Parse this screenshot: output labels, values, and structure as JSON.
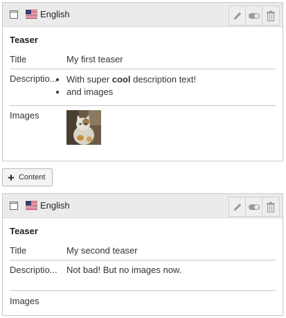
{
  "elements": [
    {
      "language": "English",
      "content_type": "Teaser",
      "fields": {
        "title_label": "Title",
        "title_value": "My first teaser",
        "description_label": "Descriptio...",
        "description_items": [
          {
            "before": "With super ",
            "bold": "cool",
            "after": " description text!"
          },
          {
            "before": "and images",
            "bold": "",
            "after": ""
          }
        ],
        "images_label": "Images"
      }
    },
    {
      "language": "English",
      "content_type": "Teaser",
      "fields": {
        "title_label": "Title",
        "title_value": "My second teaser",
        "description_label": "Descriptio...",
        "description_text": "Not bad! But no images now.",
        "images_label": "Images"
      }
    }
  ],
  "add_button_label": "Content",
  "icons": {
    "collapse": "collapse-toggle-icon",
    "flag": "us-flag-icon",
    "edit": "pencil-icon",
    "toggle": "toggle-visibility-icon",
    "delete": "trash-icon",
    "add": "plus-icon"
  },
  "colors": {
    "header_bg": "#ebebeb",
    "border": "#c9c9c9",
    "icon_gray": "#9a9a9a"
  }
}
